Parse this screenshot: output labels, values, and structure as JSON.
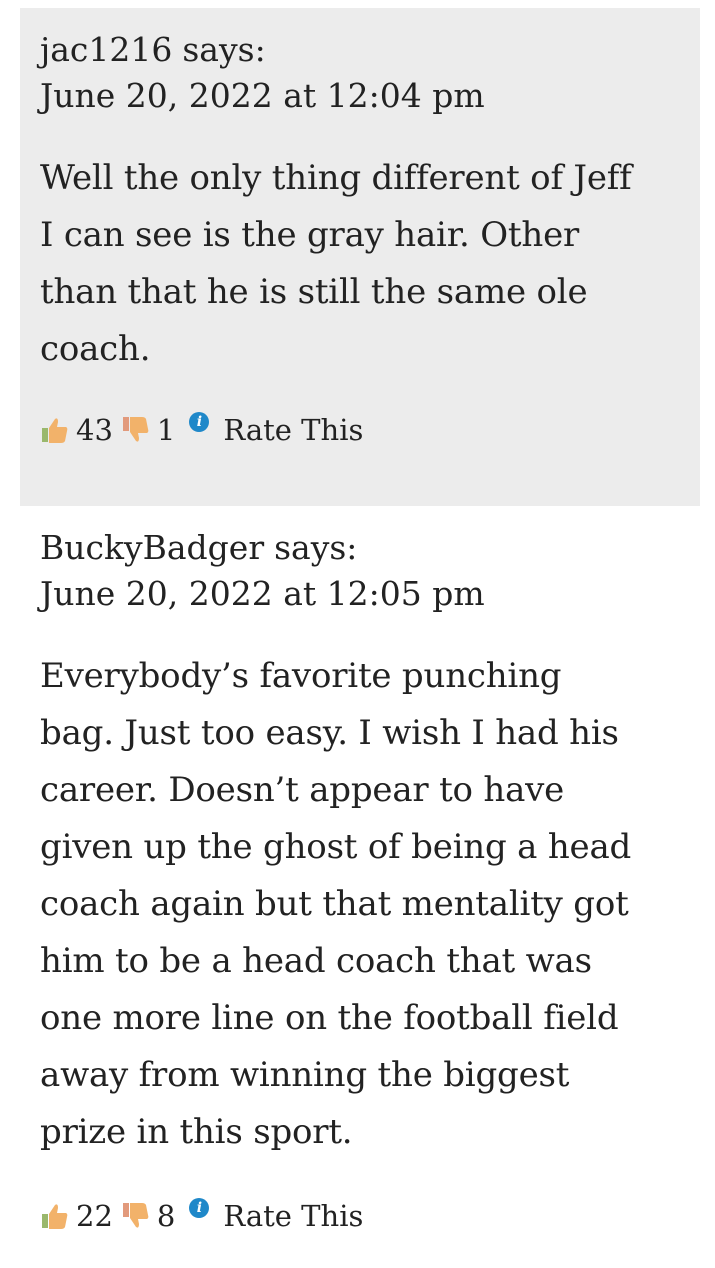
{
  "comments": [
    {
      "author": "jac1216",
      "says_label": "says:",
      "date": "June 20, 2022 at 12:04 pm",
      "body": [
        "Well the only thing different of Jeff",
        "I can see is the gray hair. Other",
        "than that he is still the same ole",
        "coach."
      ],
      "likes": "43",
      "dislikes": "1",
      "rate_label": "Rate This",
      "thumbs_up_color": "#f2b26a",
      "thumbs_down_color": "#f2b26a",
      "info_color": "#1f88c9"
    },
    {
      "author": "BuckyBadger",
      "says_label": "says:",
      "date": "June 20, 2022 at 12:05 pm",
      "body": [
        "Everybody’s favorite punching",
        "bag. Just too easy. I wish I had his",
        "career. Doesn’t appear to have",
        "given up the ghost of being a head",
        "coach again but that mentality got",
        "him to be a head coach that was",
        "one more line on the football field",
        "away from winning the biggest",
        "prize in this sport."
      ],
      "likes": "22",
      "dislikes": "8",
      "rate_label": "Rate This"
    }
  ],
  "colors": {
    "shaded_background": "#ececec",
    "text": "#222222",
    "info_icon": "#1f88c9",
    "thumb": "#f2b26a",
    "thumb_cuff": "#9ab86c"
  }
}
